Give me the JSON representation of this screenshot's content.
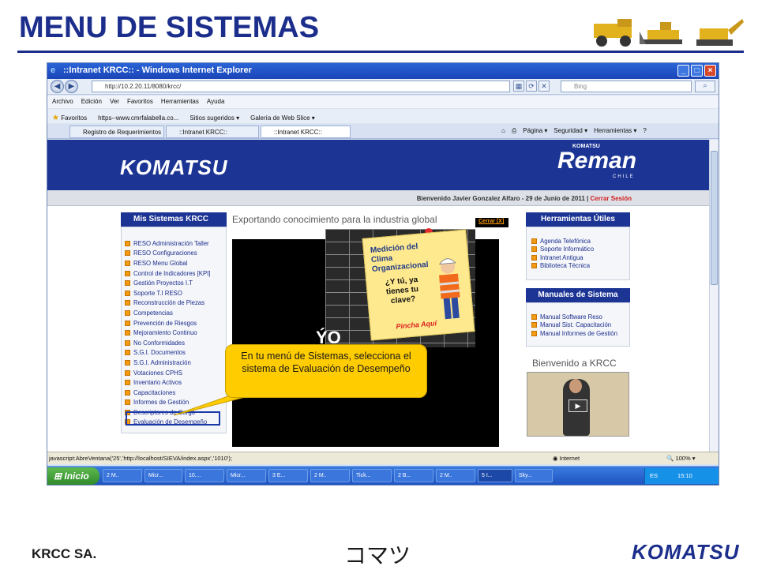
{
  "slide": {
    "title": "MENU DE SISTEMAS",
    "footer_company": "KRCC SA.",
    "footer_kana": "コマツ",
    "footer_logo": "KOMATSU"
  },
  "browser": {
    "window_title": "::Intranet KRCC:: - Windows Internet Explorer",
    "address": "http://10.2.20.11/8080/krcc/",
    "search_placeholder": "Bing",
    "menu": [
      "Archivo",
      "Edición",
      "Ver",
      "Favoritos",
      "Herramientas",
      "Ayuda"
    ],
    "favorites": [
      "Favoritos",
      "https--www.cmrfalabella.co...",
      "Sitios sugeridos ▾",
      "Galería de Web Slice ▾"
    ],
    "tabs": [
      "Registro de Requerimientos ...",
      "::Intranet KRCC::",
      "::Intranet KRCC::"
    ],
    "commands": [
      "Página ▾",
      "Seguridad ▾",
      "Herramientas ▾"
    ],
    "status_url": "javascript:AbreVentana('25','http://localhost/SIEVA/index.aspx','1010');",
    "status_zone": "Internet",
    "zoom": "100%"
  },
  "site": {
    "logo": "KOMATSU",
    "reman_logo": "Reman",
    "reman_sub": "KOMATSU",
    "reman_chile": "CHILE",
    "welcome": "Bienvenido Javier Gonzalez Alfaro - 29 de Junio de 2011 |",
    "logout": "Cerrar Sesión",
    "left_title": "Mis Sistemas KRCC",
    "systems": [
      "RESO Administración Taller",
      "RESO Configuraciones",
      "RESO Menu Global",
      "Control de Indicadores [KPI]",
      "Gestión Proyectos I.T",
      "Soporte T.I RESO",
      "Reconstrucción de Piezas",
      "Competencias",
      "Prevención de Riesgos",
      "Mejoramiento Continuo",
      "No Conformidades",
      "S.G.I. Documentos",
      "S.G.I. Administración",
      "Votaciones CPHS",
      "Inventario Activos",
      "Capacitaciones",
      "Informes de Gestión",
      "Descriptores de Cargo",
      "Evaluación de Desempeño"
    ],
    "center_title": "Exportando conocimiento para la industria global",
    "close_link": "Cerrar [X]",
    "poster_title": "Medición del Clima Organizacional",
    "poster_question": "¿Y tú, ya tienes tu clave?",
    "poster_cta": "Pincha Aquí",
    "tools_title": "Herramientas Útiles",
    "tools": [
      "Agenda Telefónica",
      "Soporte Informático",
      "Intranet Antigua",
      "Biblioteca Técnica"
    ],
    "manuals_title": "Manuales de Sistema",
    "manuals": [
      "Manual Software Reso",
      "Manual Sist. Capacitación",
      "Manual Informes de Gestión"
    ],
    "welcome_video_title": "Bienvenido a KRCC"
  },
  "taskbar": {
    "start": "Inicio",
    "buttons": [
      "2 M..",
      "Micr...",
      "10....",
      "Micr...",
      "3 E...",
      "2 M..",
      "Tick...",
      "2 B...",
      "2 M..",
      "5 I...",
      "Sky..."
    ],
    "lang": "ES",
    "time": "15:10"
  },
  "callout": {
    "text": "En tu menú de Sistemas, selecciona el sistema de Evaluación de Desempeño"
  },
  "colors": {
    "brand_blue": "#1c3494",
    "title_blue": "#1c2e8c",
    "callout_yellow": "#ffcc00",
    "bullet_orange": "#f29a12"
  }
}
